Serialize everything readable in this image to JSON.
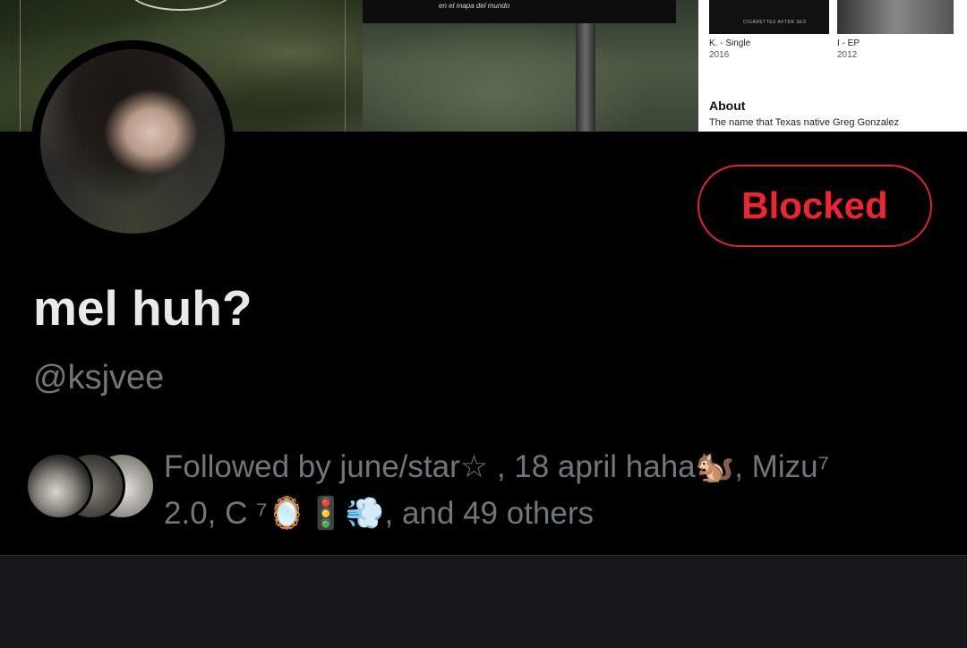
{
  "banner": {
    "caption": "en el mapa del mundo",
    "albums": [
      {
        "title": "K. - Single",
        "year": "2016"
      },
      {
        "title": "I - EP",
        "year": "2012"
      }
    ],
    "thumb_caption": "CIGARETTES AFTER SEX",
    "about_heading": "About",
    "about_text": "The name that Texas native Greg Gonzalez"
  },
  "profile": {
    "display_name": "mel huh?",
    "handle": "@ksjvee",
    "block_button_label": "Blocked"
  },
  "followed_by": {
    "line1": "Followed by june/star☆ , 18 april haha🐿️, Mizu⁷",
    "line2": "2.0, C ⁷🪞🚦💨, and 49 others"
  },
  "colors": {
    "background": "#000000",
    "primary_text": "#e7e9ea",
    "secondary_text": "#71767b",
    "blocked_red": "#f0232e",
    "bottom_bar": "#16181c"
  }
}
